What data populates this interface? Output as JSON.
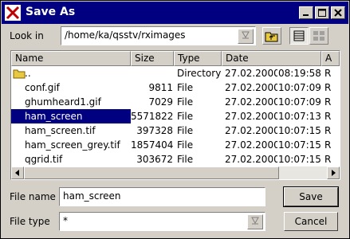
{
  "window": {
    "title": "Save As",
    "controls": {
      "minimize": "_",
      "maximize": "□",
      "close": "✕"
    }
  },
  "lookin": {
    "label": "Look in",
    "path": "/home/ka/qsstv/rximages"
  },
  "columns": {
    "name": "Name",
    "size": "Size",
    "type": "Type",
    "date": "Date",
    "attr": "A"
  },
  "files": [
    {
      "name": "..",
      "size": "",
      "type": "Directory",
      "date": "27.02.2000",
      "time": "08:19:58",
      "attr": "R",
      "is_folder": true
    },
    {
      "name": "conf.gif",
      "size": "9811",
      "type": "File",
      "date": "27.02.2000",
      "time": "10:07:09",
      "attr": "R"
    },
    {
      "name": "ghumheard1.gif",
      "size": "7029",
      "type": "File",
      "date": "27.02.2000",
      "time": "10:07:09",
      "attr": "R"
    },
    {
      "name": "ham_screen",
      "size": "5571822",
      "type": "File",
      "date": "27.02.2000",
      "time": "10:07:13",
      "attr": "R",
      "selected": true
    },
    {
      "name": "ham_screen.tif",
      "size": "397328",
      "type": "File",
      "date": "27.02.2000",
      "time": "10:07:15",
      "attr": "R"
    },
    {
      "name": "ham_screen_grey.tif",
      "size": "1857404",
      "type": "File",
      "date": "27.02.2000",
      "time": "10:07:15",
      "attr": "R"
    },
    {
      "name": "qgrid.tif",
      "size": "303672",
      "type": "File",
      "date": "27.02.2000",
      "time": "10:07:15",
      "attr": "R"
    }
  ],
  "filename": {
    "label": "File name",
    "value": "ham_screen"
  },
  "filetype": {
    "label": "File type",
    "value": "*"
  },
  "buttons": {
    "save": "Save",
    "cancel": "Cancel"
  },
  "colors": {
    "titlebar": "#000080",
    "selection": "#000080",
    "face": "#d4d0c8"
  }
}
